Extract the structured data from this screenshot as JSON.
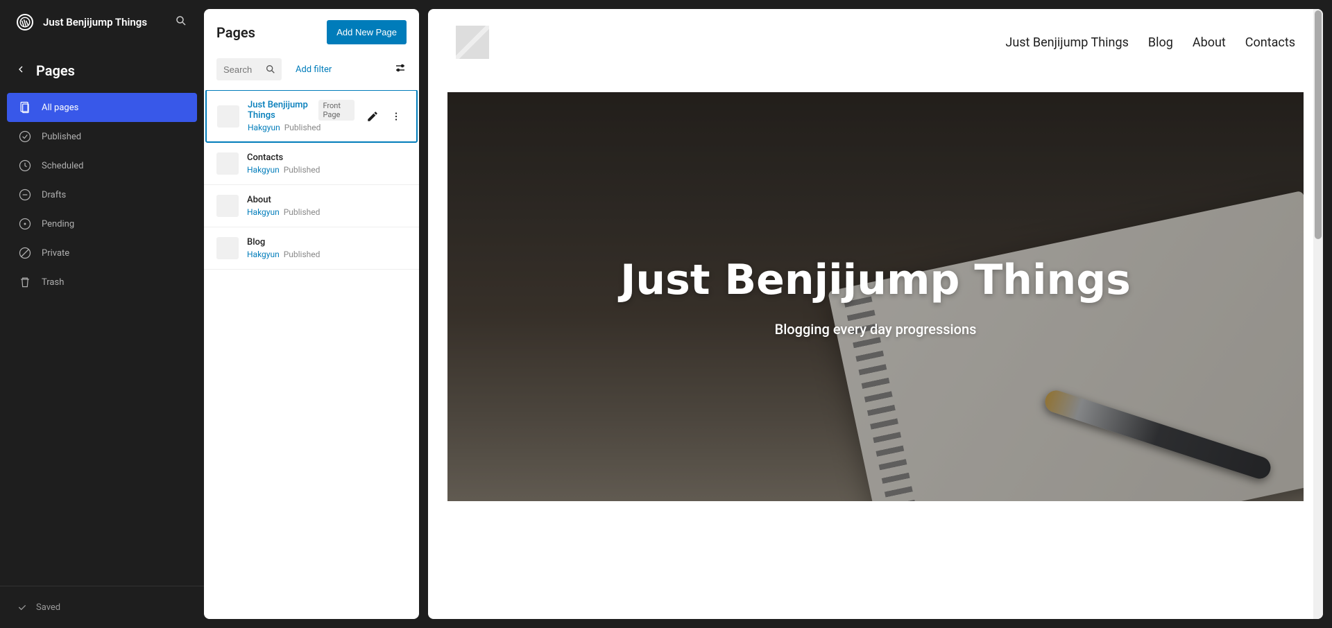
{
  "site_title": "Just Benjijump Things",
  "nav": {
    "title": "Pages",
    "items": [
      {
        "label": "All pages",
        "active": true
      },
      {
        "label": "Published"
      },
      {
        "label": "Scheduled"
      },
      {
        "label": "Drafts"
      },
      {
        "label": "Pending"
      },
      {
        "label": "Private"
      },
      {
        "label": "Trash"
      }
    ]
  },
  "footer_status": "Saved",
  "pages_panel": {
    "title": "Pages",
    "add_button": "Add New Page",
    "search_placeholder": "Search",
    "add_filter": "Add filter",
    "items": [
      {
        "title": "Just Benjijump Things",
        "badge": "Front Page",
        "author": "Hakgyun",
        "status": "Published",
        "selected": true
      },
      {
        "title": "Contacts",
        "author": "Hakgyun",
        "status": "Published"
      },
      {
        "title": "About",
        "author": "Hakgyun",
        "status": "Published"
      },
      {
        "title": "Blog",
        "author": "Hakgyun",
        "status": "Published"
      }
    ]
  },
  "preview": {
    "nav_items": [
      "Just Benjijump Things",
      "Blog",
      "About",
      "Contacts"
    ],
    "hero_title": "Just Benjijump Things",
    "hero_subtitle": "Blogging every day progressions"
  }
}
